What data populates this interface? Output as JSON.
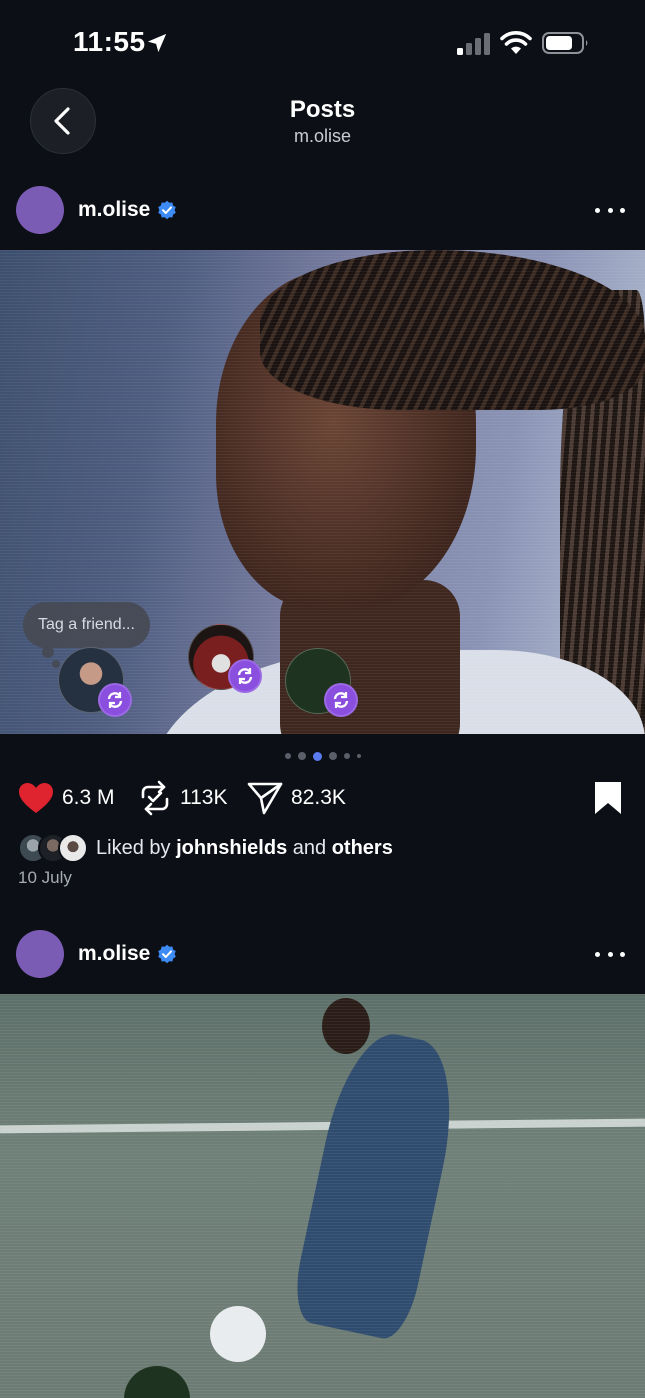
{
  "status_bar": {
    "time": "11:55"
  },
  "nav": {
    "title": "Posts",
    "subtitle": "m.olise"
  },
  "posts": [
    {
      "username": "m.olise",
      "verified": true,
      "tag_prompt": "Tag a friend...",
      "carousel": {
        "count": 6,
        "active_index": 2
      },
      "likes": "6.3 M",
      "reposts": "113K",
      "shares": "82.3K",
      "liked_by_prefix": "Liked by",
      "liked_by_user": "johnshields",
      "liked_by_and": "and",
      "liked_by_others": "others",
      "date": "10 July"
    },
    {
      "username": "m.olise",
      "verified": true
    }
  ],
  "colors": {
    "background": "#0c0f16",
    "accent": "#5b7cf0",
    "like": "#e0242f",
    "verified": "#3d8bf5",
    "repost_badge": "#8b4fe0"
  },
  "icons": [
    "location-arrow-icon",
    "signal-icon",
    "wifi-icon",
    "battery-icon",
    "chevron-left-icon",
    "verified-badge-icon",
    "more-icon",
    "heart-icon",
    "repost-icon",
    "share-icon",
    "bookmark-icon"
  ]
}
